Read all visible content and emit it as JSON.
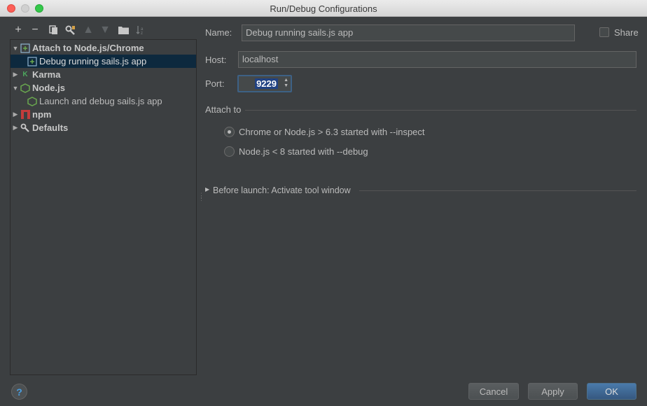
{
  "window": {
    "title": "Run/Debug Configurations"
  },
  "toolbar": {
    "add_icon": "plus-icon",
    "remove_icon": "minus-icon",
    "copy_icon": "copy-icon",
    "edit_defaults_icon": "wrench-icon",
    "move_up_icon": "arrow-up-icon",
    "move_down_icon": "arrow-down-icon",
    "folder_icon": "folder-icon",
    "sort_icon": "sort-icon"
  },
  "tree": {
    "items": [
      {
        "label": "Attach to Node.js/Chrome",
        "expanded": true
      },
      {
        "label": "Debug running sails.js app",
        "selected": true
      },
      {
        "label": "Karma",
        "expanded": false
      },
      {
        "label": "Node.js",
        "expanded": true
      },
      {
        "label": "Launch and debug sails.js app"
      },
      {
        "label": "npm",
        "expanded": false
      },
      {
        "label": "Defaults",
        "expanded": false
      }
    ]
  },
  "form": {
    "name_label": "Name:",
    "name_value": "Debug running sails.js app",
    "share_label": "Share",
    "share_checked": false,
    "host_label": "Host:",
    "host_value": "localhost",
    "port_label": "Port:",
    "port_value": "9229",
    "attach_to_title": "Attach to",
    "attach_options": [
      {
        "label": "Chrome or Node.js > 6.3 started with --inspect",
        "checked": true
      },
      {
        "label": "Node.js < 8 started with --debug",
        "checked": false
      }
    ],
    "before_launch": "Before launch: Activate tool window"
  },
  "buttons": {
    "help": "?",
    "cancel": "Cancel",
    "apply": "Apply",
    "ok": "OK"
  },
  "colors": {
    "background": "#3c3f41",
    "selection": "#0d293e",
    "primary_button": "#365880",
    "field": "#45494a"
  }
}
